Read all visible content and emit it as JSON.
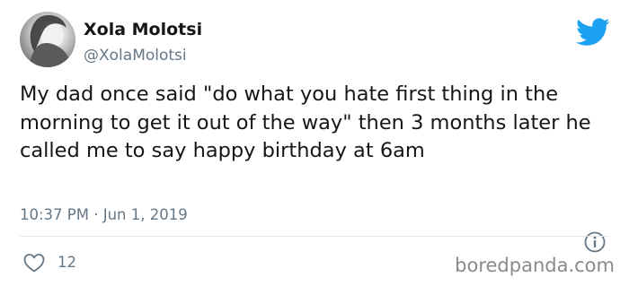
{
  "tweet": {
    "display_name": "Xola Molotsi",
    "handle": "@XolaMolotsi",
    "text": "My dad once said \"do what you hate first thing in the morning to get it out of the way\" then 3 months later he called me to say happy birthday at 6am",
    "timestamp": "10:37 PM · Jun 1, 2019",
    "like_count": "12"
  },
  "icons": {
    "brand": "twitter-bird-icon",
    "info": "info-icon",
    "like": "heart-icon"
  },
  "colors": {
    "twitter_blue": "#1da1f2",
    "text_primary": "#14171a",
    "text_secondary": "#657786",
    "divider": "#e1e8ed"
  },
  "watermark": "boredpanda.com"
}
